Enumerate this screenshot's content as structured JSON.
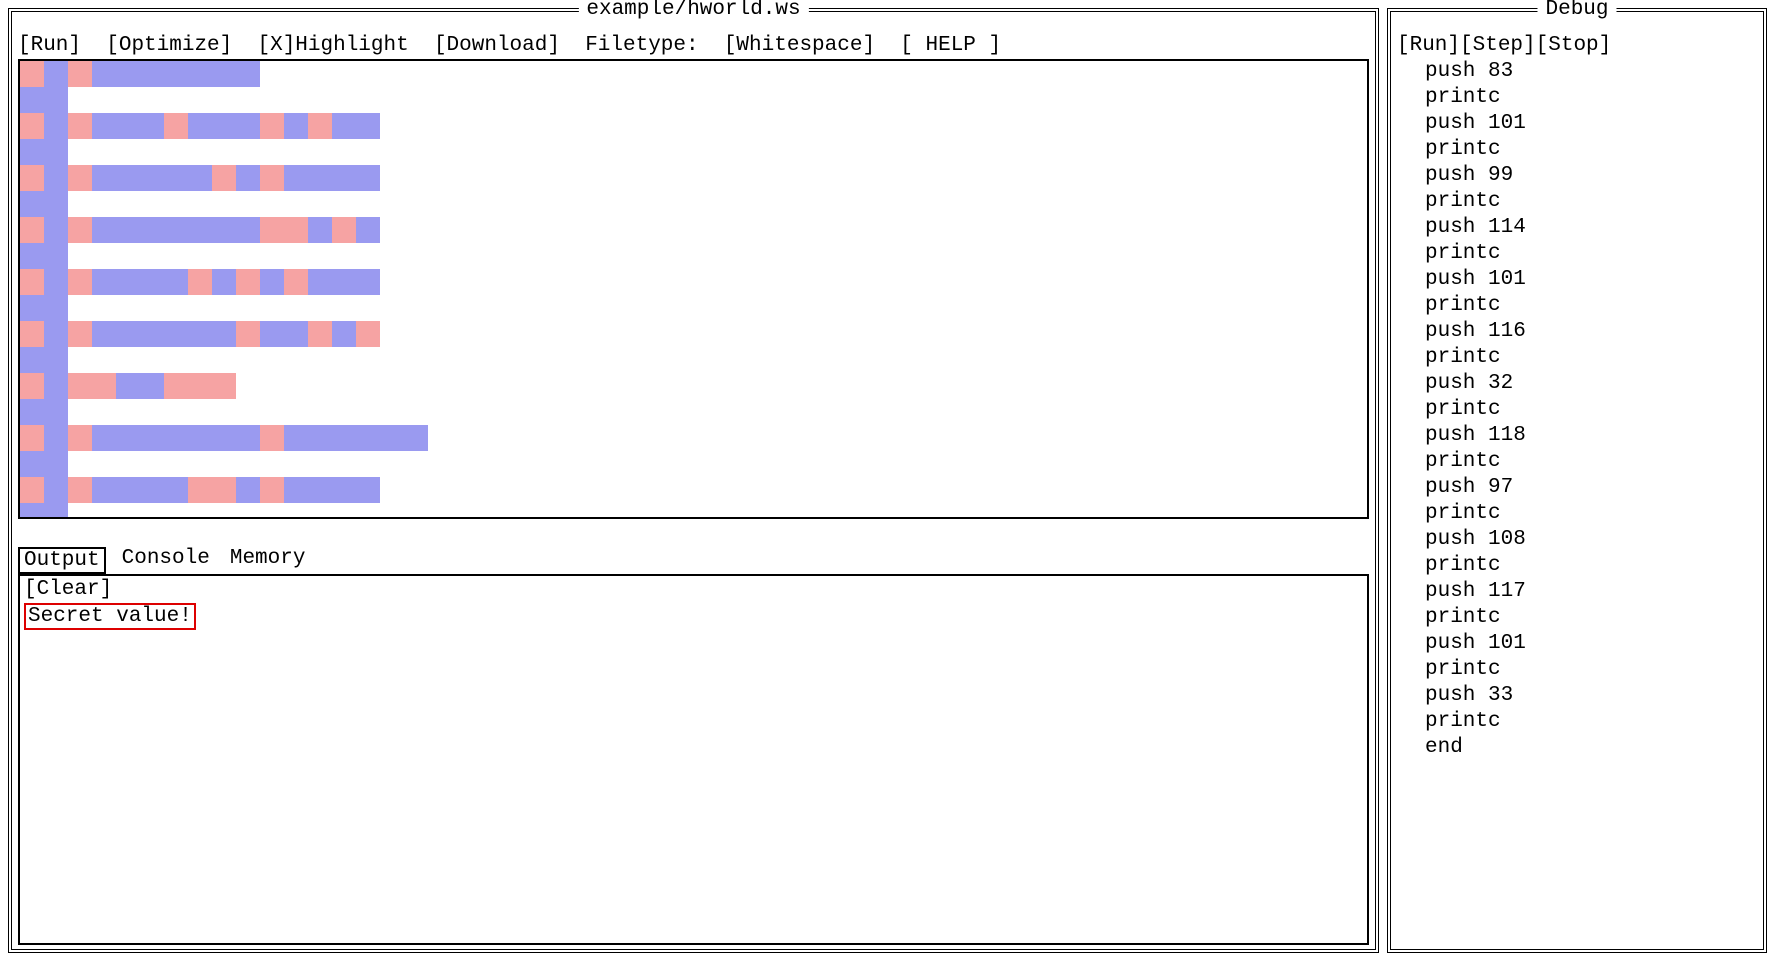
{
  "main": {
    "title": "example/hworld.ws",
    "toolbar": {
      "run": "[Run]",
      "optimize": "[Optimize]",
      "highlight": "[X]Highlight",
      "download": "[Download]",
      "filetype_label": "Filetype:",
      "filetype_value": "[Whitespace]",
      "help": "[ HELP ]"
    },
    "editor_rows": [
      "STSTTTTTTT",
      "TT",
      "STSTTTSTTTSTSTT",
      "TT",
      "STSTTTTTSTSTTTT",
      "TT",
      "STSTTTTTTTSSTST",
      "TT",
      "STSTTTTSTSTSTTT",
      "TT",
      "STSTTTTTTSTTSTS",
      "TT",
      "STSSTTSSS",
      "TT",
      "STSTTTTTTTSTTTTTT",
      "TT",
      "STSTTTTSSTSTTTT",
      "TT"
    ],
    "tabs": {
      "output": "Output",
      "console": "Console",
      "memory": "Memory"
    },
    "output": {
      "clear": "[Clear]",
      "text": "Secret value!"
    }
  },
  "debug": {
    "title": "Debug",
    "toolbar": {
      "run": "[Run]",
      "step": "[Step]",
      "stop": "[Stop]"
    },
    "instructions": [
      "push 83",
      "printc",
      "push 101",
      "printc",
      "push 99",
      "printc",
      "push 114",
      "printc",
      "push 101",
      "printc",
      "push 116",
      "printc",
      "push 32",
      "printc",
      "push 118",
      "printc",
      "push 97",
      "printc",
      "push 108",
      "printc",
      "push 117",
      "printc",
      "push 101",
      "printc",
      "push 33",
      "printc",
      "end"
    ]
  },
  "colors": {
    "space": "#f6a3a3",
    "tab": "#9a9af0",
    "highlight_box": "#d00"
  }
}
